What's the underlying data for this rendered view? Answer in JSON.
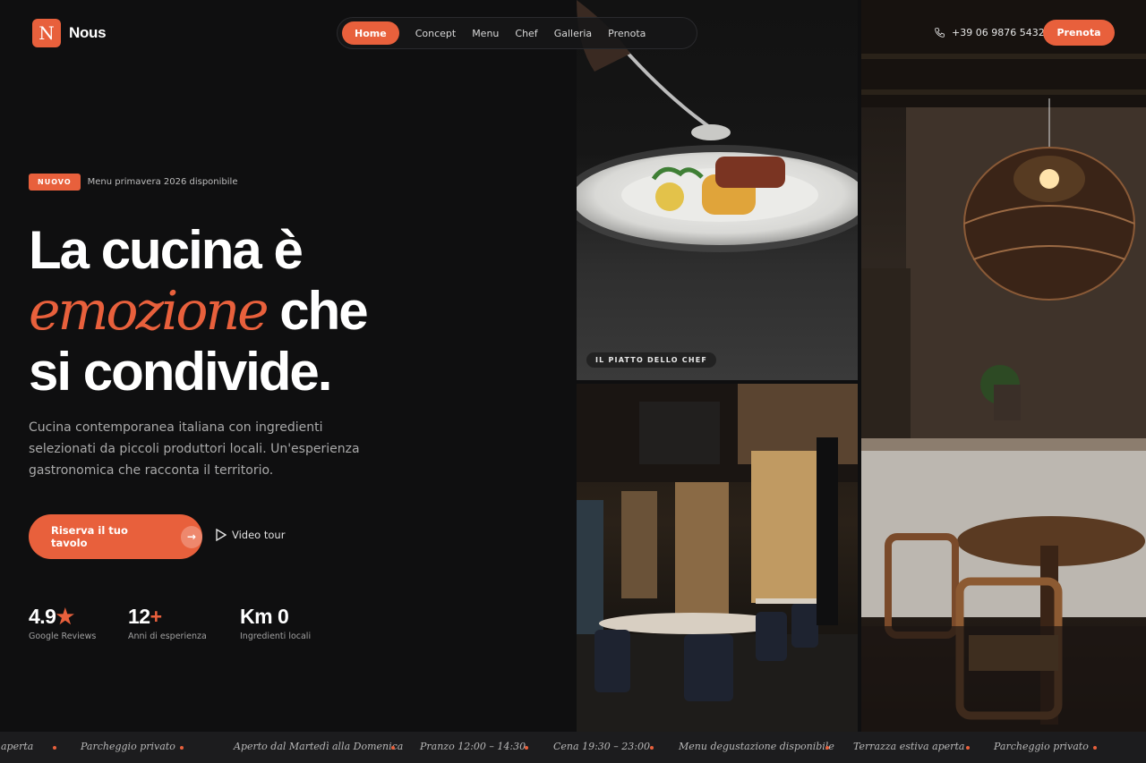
{
  "brand": {
    "mark": "N",
    "name": "Nous",
    "accent": "#e8603c"
  },
  "nav": {
    "items": [
      {
        "label": "Home",
        "active": true
      },
      {
        "label": "Concept"
      },
      {
        "label": "Menu"
      },
      {
        "label": "Chef"
      },
      {
        "label": "Galleria"
      },
      {
        "label": "Prenota"
      }
    ]
  },
  "header": {
    "phone": "+39 06 9876 5432",
    "phone_icon": "phone-icon",
    "book_label": "Prenota"
  },
  "hero": {
    "badge": "NUOVO",
    "badge_text": "Menu primavera 2026 disponibile",
    "headline_line1": "La cucina è",
    "headline_accent": "emozione",
    "headline_line2_rest": "che",
    "headline_line3": "si condivide.",
    "description": "Cucina contemporanea italiana con ingredienti selezionati da piccoli produttori locali. Un'esperienza gastronomica che racconta il territorio.",
    "cta_label": "Riserva il tuo tavolo",
    "video_label": "Video tour"
  },
  "stats": [
    {
      "value": "4.9",
      "suffix": "★",
      "label": "Google Reviews"
    },
    {
      "value": "12",
      "suffix": "+",
      "label": "Anni di esperienza"
    },
    {
      "value": "Km 0",
      "suffix": "",
      "label": "Ingredienti locali"
    }
  ],
  "gallery": {
    "chef_tag": "IL PIATTO DELLO CHEF"
  },
  "ticker": [
    "aperta",
    "Parcheggio privato",
    "Aperto dal Martedì alla Domenica",
    "Pranzo 12:00 – 14:30",
    "Cena 19:30 – 23:00",
    "Menu degustazione disponibile",
    "Terrazza estiva aperta",
    "Parcheggio privato"
  ]
}
